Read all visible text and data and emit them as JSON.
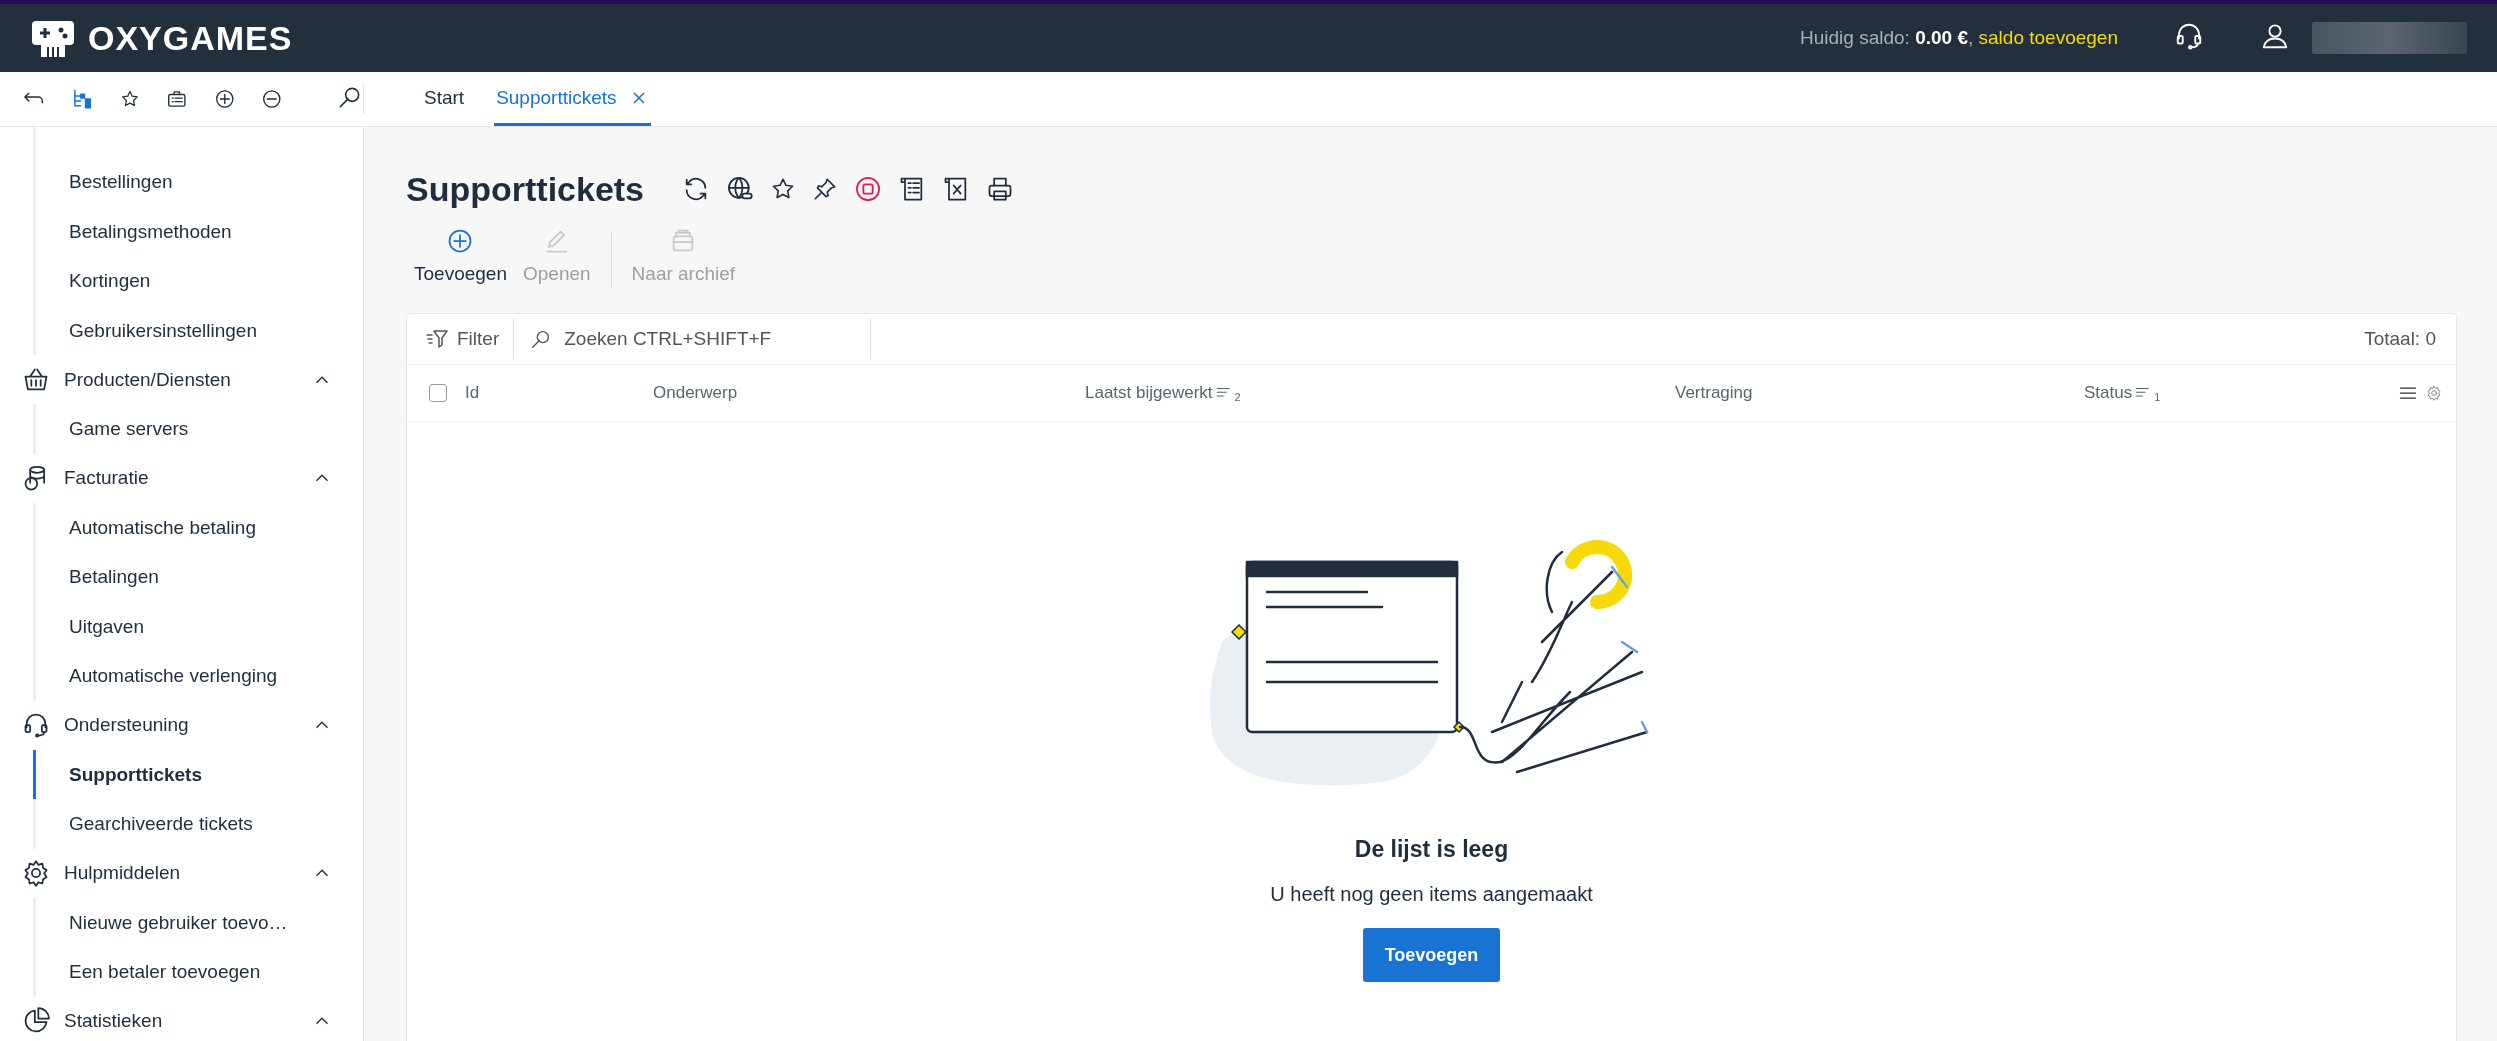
{
  "header": {
    "logo": "OXYGAMES",
    "balance": {
      "text": "Huidig saldo: **0.00 €**,",
      "link": "saldo toevoegen"
    }
  },
  "toolbar_tabs": [
    {
      "label": "Start",
      "selected": false,
      "closable": false
    },
    {
      "label": "Supporttickets",
      "selected": true,
      "closable": true
    }
  ],
  "sidebar": {
    "groups": [
      {
        "items": [
          {
            "label": "Bestellingen",
            "selected": false
          },
          {
            "label": "Betalingsmethoden",
            "selected": false
          },
          {
            "label": "Kortingen",
            "selected": false
          },
          {
            "label": "Gebruikersinstellingen",
            "selected": false
          }
        ]
      },
      {
        "label": "Producten/Diensten",
        "expanded": true,
        "items": [
          {
            "label": "Game servers",
            "selected": false
          }
        ]
      },
      {
        "label": "Facturatie",
        "expanded": true,
        "items": [
          {
            "label": "Automatische betaling",
            "selected": false
          },
          {
            "label": "Betalingen",
            "selected": false
          },
          {
            "label": "Uitgaven",
            "selected": false
          },
          {
            "label": "Automatische verlenging",
            "selected": false
          }
        ]
      },
      {
        "label": "Ondersteuning",
        "expanded": true,
        "items": [
          {
            "label": "Supporttickets",
            "selected": true
          },
          {
            "label": "Gearchiveerde tickets",
            "selected": false
          }
        ]
      },
      {
        "label": "Hulpmiddelen",
        "expanded": true,
        "items": [
          {
            "label": "Nieuwe gebruiker toevo…",
            "selected": false
          },
          {
            "label": "Een betaler toevoegen",
            "selected": false
          }
        ]
      },
      {
        "label": "Statistieken",
        "expanded": true
      }
    ]
  },
  "page": {
    "title": "Supporttickets",
    "actions": [
      {
        "label": "Toevoegen",
        "disabled": false
      },
      {
        "label": "Openen",
        "disabled": true
      },
      {
        "label": "Naar archief",
        "disabled": true
      }
    ],
    "filter": "Filter",
    "search": {
      "placeholder": "Zoeken CTRL+SHIFT+F"
    },
    "total": "Totaal: 0",
    "columns": [
      {
        "label": "Id"
      },
      {
        "label": "Onderwerp"
      },
      {
        "label": "Laatst bijgewerkt",
        "sort_order": "2"
      },
      {
        "label": "Vertraging"
      },
      {
        "label": "Status",
        "sort_order": "1"
      }
    ],
    "select_all": {
      "checked": false
    },
    "empty": {
      "title": "De lijst is leeg",
      "text": "U heeft nog geen items aangemaakt",
      "button": "Toevoegen"
    }
  }
}
